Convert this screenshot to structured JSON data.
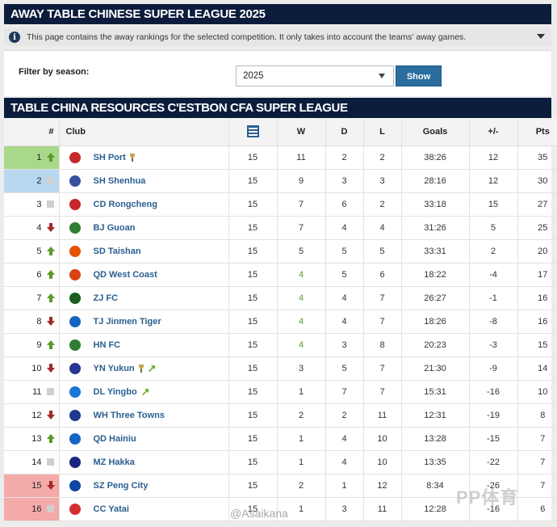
{
  "page_title": "AWAY TABLE CHINESE SUPER LEAGUE 2025",
  "info_text": "This page contains the away rankings for the selected competition. It only takes into account the teams' away games.",
  "filter": {
    "label": "Filter by season:",
    "selected": "2025",
    "button": "Show"
  },
  "table_title": "TABLE CHINA RESOURCES C'ESTBON CFA SUPER LEAGUE",
  "columns": {
    "rank": "#",
    "club": "Club",
    "w": "W",
    "d": "D",
    "l": "L",
    "goals": "Goals",
    "diff": "+/-",
    "pts": "Pts"
  },
  "rows": [
    {
      "rank": "1",
      "trend": "up",
      "club": "SH Port",
      "trophy": true,
      "promo": false,
      "crest": "#c62828",
      "pl": "15",
      "w": "11",
      "d": "2",
      "l": "2",
      "goals": "38:26",
      "diff": "12",
      "pts": "35",
      "bg": "green",
      "wgreen": false
    },
    {
      "rank": "2",
      "trend": "same",
      "club": "SH Shenhua",
      "trophy": false,
      "promo": false,
      "crest": "#3a4fa0",
      "pl": "15",
      "w": "9",
      "d": "3",
      "l": "3",
      "goals": "28:16",
      "diff": "12",
      "pts": "30",
      "bg": "blue",
      "wgreen": false
    },
    {
      "rank": "3",
      "trend": "same",
      "club": "CD Rongcheng",
      "trophy": false,
      "promo": false,
      "crest": "#c62828",
      "pl": "15",
      "w": "7",
      "d": "6",
      "l": "2",
      "goals": "33:18",
      "diff": "15",
      "pts": "27",
      "bg": "",
      "wgreen": false
    },
    {
      "rank": "4",
      "trend": "down",
      "club": "BJ Guoan",
      "trophy": false,
      "promo": false,
      "crest": "#2e7d32",
      "pl": "15",
      "w": "7",
      "d": "4",
      "l": "4",
      "goals": "31:26",
      "diff": "5",
      "pts": "25",
      "bg": "",
      "wgreen": false
    },
    {
      "rank": "5",
      "trend": "up",
      "club": "SD Taishan",
      "trophy": false,
      "promo": false,
      "crest": "#e65100",
      "pl": "15",
      "w": "5",
      "d": "5",
      "l": "5",
      "goals": "33:31",
      "diff": "2",
      "pts": "20",
      "bg": "",
      "wgreen": false
    },
    {
      "rank": "6",
      "trend": "up",
      "club": "QD West Coast",
      "trophy": false,
      "promo": false,
      "crest": "#d84315",
      "pl": "15",
      "w": "4",
      "d": "5",
      "l": "6",
      "goals": "18:22",
      "diff": "-4",
      "pts": "17",
      "bg": "",
      "wgreen": true
    },
    {
      "rank": "7",
      "trend": "up",
      "club": "ZJ FC",
      "trophy": false,
      "promo": false,
      "crest": "#1b5e20",
      "pl": "15",
      "w": "4",
      "d": "4",
      "l": "7",
      "goals": "26:27",
      "diff": "-1",
      "pts": "16",
      "bg": "",
      "wgreen": true
    },
    {
      "rank": "8",
      "trend": "down",
      "club": "TJ Jinmen Tiger",
      "trophy": false,
      "promo": false,
      "crest": "#1565c0",
      "pl": "15",
      "w": "4",
      "d": "4",
      "l": "7",
      "goals": "18:26",
      "diff": "-8",
      "pts": "16",
      "bg": "",
      "wgreen": true
    },
    {
      "rank": "9",
      "trend": "up",
      "club": "HN FC",
      "trophy": false,
      "promo": false,
      "crest": "#2e7d32",
      "pl": "15",
      "w": "4",
      "d": "3",
      "l": "8",
      "goals": "20:23",
      "diff": "-3",
      "pts": "15",
      "bg": "",
      "wgreen": true
    },
    {
      "rank": "10",
      "trend": "down",
      "club": "YN Yukun",
      "trophy": true,
      "promo": true,
      "crest": "#283593",
      "pl": "15",
      "w": "3",
      "d": "5",
      "l": "7",
      "goals": "21:30",
      "diff": "-9",
      "pts": "14",
      "bg": "",
      "wgreen": false
    },
    {
      "rank": "11",
      "trend": "same",
      "club": "DL Yingbo",
      "trophy": false,
      "promo": true,
      "crest": "#1976d2",
      "pl": "15",
      "w": "1",
      "d": "7",
      "l": "7",
      "goals": "15:31",
      "diff": "-16",
      "pts": "10",
      "bg": "",
      "wgreen": false
    },
    {
      "rank": "12",
      "trend": "down",
      "club": "WH Three Towns",
      "trophy": false,
      "promo": false,
      "crest": "#1e3a8a",
      "pl": "15",
      "w": "2",
      "d": "2",
      "l": "11",
      "goals": "12:31",
      "diff": "-19",
      "pts": "8",
      "bg": "",
      "wgreen": false
    },
    {
      "rank": "13",
      "trend": "up",
      "club": "QD Hainiu",
      "trophy": false,
      "promo": false,
      "crest": "#1565c0",
      "pl": "15",
      "w": "1",
      "d": "4",
      "l": "10",
      "goals": "13:28",
      "diff": "-15",
      "pts": "7",
      "bg": "",
      "wgreen": false
    },
    {
      "rank": "14",
      "trend": "same",
      "club": "MZ Hakka",
      "trophy": false,
      "promo": false,
      "crest": "#1a237e",
      "pl": "15",
      "w": "1",
      "d": "4",
      "l": "10",
      "goals": "13:35",
      "diff": "-22",
      "pts": "7",
      "bg": "",
      "wgreen": false
    },
    {
      "rank": "15",
      "trend": "down",
      "club": "SZ Peng City",
      "trophy": false,
      "promo": false,
      "crest": "#0d47a1",
      "pl": "15",
      "w": "2",
      "d": "1",
      "l": "12",
      "goals": "8:34",
      "diff": "-26",
      "pts": "7",
      "bg": "red",
      "wgreen": false
    },
    {
      "rank": "16",
      "trend": "same",
      "club": "CC Yatai",
      "trophy": false,
      "promo": false,
      "crest": "#d32f2f",
      "pl": "15",
      "w": "1",
      "d": "3",
      "l": "11",
      "goals": "12:28",
      "diff": "-16",
      "pts": "6",
      "bg": "red",
      "wgreen": false
    }
  ],
  "watermark": "@Asaikana",
  "watermark_logo": "PP体育"
}
